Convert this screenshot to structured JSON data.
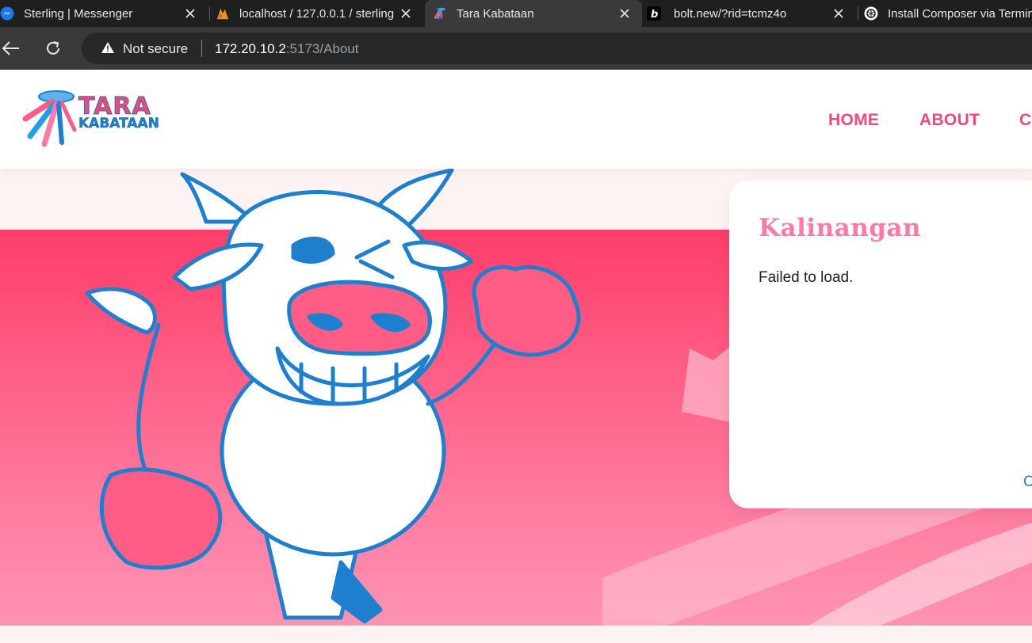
{
  "browser": {
    "tabs": [
      {
        "title": "Sterling | Messenger",
        "icon": "messenger-icon"
      },
      {
        "title": "localhost / 127.0.0.1 / sterling",
        "icon": "phpmyadmin-icon"
      },
      {
        "title": "Tara Kabataan",
        "icon": "tara-kabataan-icon",
        "active": true
      },
      {
        "title": "bolt.new/?rid=tcmz4o",
        "icon": "bolt-icon"
      },
      {
        "title": "Install Composer via Termin",
        "icon": "openai-icon"
      }
    ],
    "security_label": "Not secure",
    "url_host": "172.20.10.2",
    "url_rest": ":5173/About",
    "colors": {
      "tabstrip": "#1f1f1f",
      "toolbar": "#3a3a3a",
      "omnibox": "#282828"
    }
  },
  "site": {
    "logo": {
      "line1": "TARA",
      "line2": "KABATAAN"
    },
    "nav": [
      "HOME",
      "ABOUT",
      "CO"
    ],
    "colors": {
      "brand_pink": "#f2477a",
      "brand_blue": "#1e7fcf",
      "hero_top": "#ff3d6a",
      "hero_bottom": "#ff93b2"
    }
  },
  "card": {
    "title": "Kalinangan",
    "message": "Failed to load.",
    "link_label": "C"
  },
  "mascot": {
    "name": "cow-mascot-illustration"
  }
}
